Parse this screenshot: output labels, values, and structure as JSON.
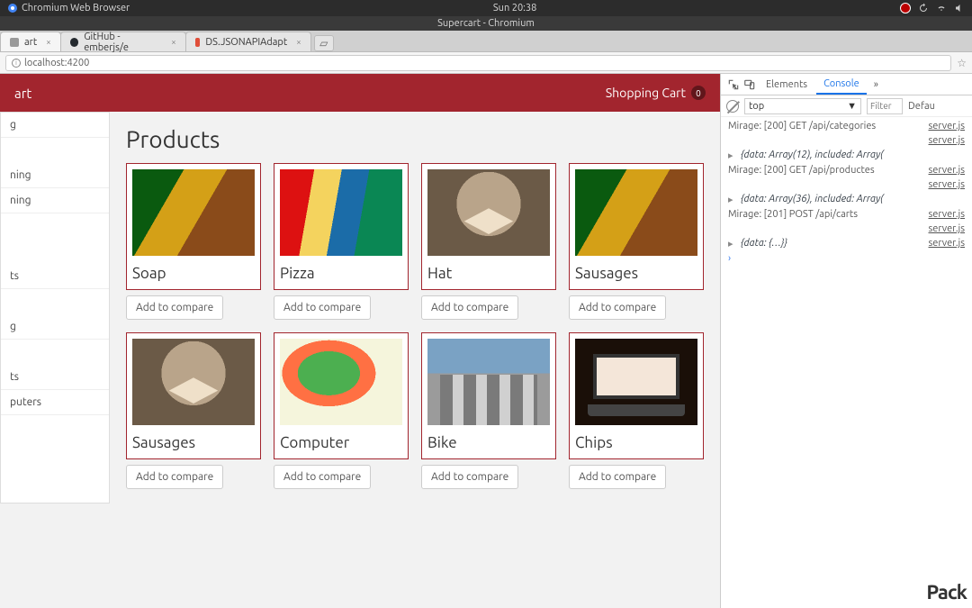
{
  "ubuntu": {
    "app_label": "Chromium Web Browser",
    "clock": "Sun 20:38"
  },
  "window": {
    "title": "Supercart - Chromium"
  },
  "tabs": [
    {
      "label": "art",
      "active": true
    },
    {
      "label": "GitHub - emberjs/e"
    },
    {
      "label": "DS.JSONAPIAdapt"
    }
  ],
  "address": {
    "url": "localhost:4200"
  },
  "app": {
    "brand": "art",
    "cart_label": "Shopping Cart",
    "cart_count": "0"
  },
  "sidebar": {
    "items": [
      "g",
      "",
      "ning",
      "ning",
      "",
      "",
      "ts",
      "",
      "g",
      "",
      "ts",
      "puters"
    ]
  },
  "page": {
    "title": "Products",
    "compare_label": "Add to compare",
    "products": [
      {
        "name": "Soap",
        "thumb": "street"
      },
      {
        "name": "Pizza",
        "thumb": "women"
      },
      {
        "name": "Hat",
        "thumb": "cat"
      },
      {
        "name": "Sausages",
        "thumb": "street"
      },
      {
        "name": "Sausages",
        "thumb": "cat"
      },
      {
        "name": "Computer",
        "thumb": "salad"
      },
      {
        "name": "Bike",
        "thumb": "gate"
      },
      {
        "name": "Chips",
        "thumb": "laptop"
      }
    ]
  },
  "devtools": {
    "tabs": {
      "elements": "Elements",
      "console": "Console"
    },
    "context": "top",
    "filter_placeholder": "Filter",
    "levels": "Defau",
    "logs": [
      {
        "t": "msg",
        "text": "Mirage: [200] GET /api/categories",
        "src": "server.js"
      },
      {
        "t": "src",
        "src": "server.js"
      },
      {
        "t": "obj",
        "text": "{data: Array(12), included: Array("
      },
      {
        "t": "msg",
        "text": "Mirage: [200] GET /api/productes",
        "src": "server.js"
      },
      {
        "t": "src",
        "src": "server.js"
      },
      {
        "t": "obj",
        "text": "{data: Array(36), included: Array("
      },
      {
        "t": "msg",
        "text": "Mirage: [201] POST /api/carts",
        "src": "server.js"
      },
      {
        "t": "src",
        "src": "server.js"
      },
      {
        "t": "obj",
        "text": "{data: {…}}",
        "src": "server.js"
      }
    ]
  },
  "watermark": "Pack"
}
